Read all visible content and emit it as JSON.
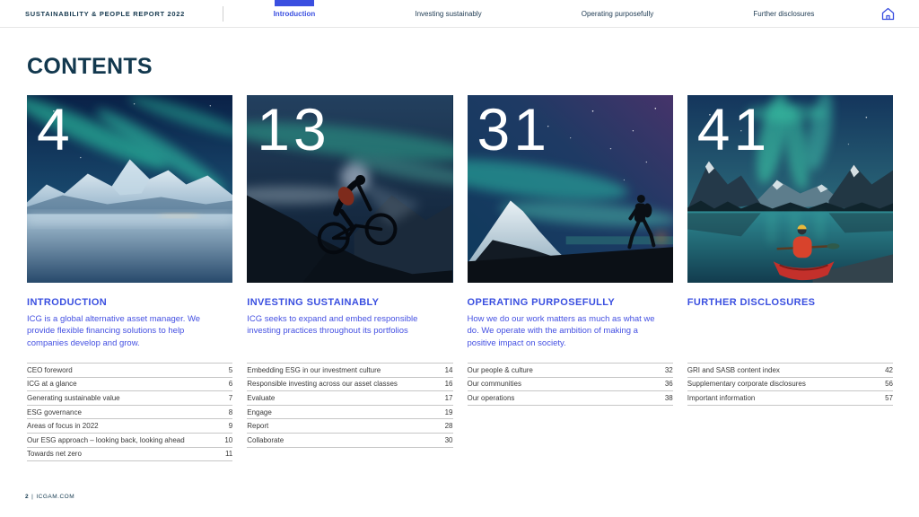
{
  "colors": {
    "accent": "#3A4FE0",
    "title_navy": "#12384E",
    "aurora_teal": "#2FD6AC"
  },
  "header": {
    "report_title": "SUSTAINABILITY & PEOPLE REPORT 2022",
    "tabs": [
      {
        "label": "Introduction",
        "active": true
      },
      {
        "label": "Investing sustainably",
        "active": false
      },
      {
        "label": "Operating purposefully",
        "active": false
      },
      {
        "label": "Further disclosures",
        "active": false
      }
    ],
    "icons": {
      "home": "home-icon"
    }
  },
  "page_title": "CONTENTS",
  "sections": [
    {
      "number": "4",
      "title": "INTRODUCTION",
      "description": "ICG is a global alternative asset manager. We provide flexible financing solutions to help companies develop and grow.",
      "image": "aurora-over-snowy-mountains-and-sea",
      "items": [
        {
          "label": "CEO foreword",
          "page": "5"
        },
        {
          "label": "ICG at a glance",
          "page": "6"
        },
        {
          "label": "Generating sustainable value",
          "page": "7"
        },
        {
          "label": "ESG governance",
          "page": "8"
        },
        {
          "label": "Areas of focus in 2022",
          "page": "9"
        },
        {
          "label": "Our ESG approach – looking back, looking ahead",
          "page": "10"
        },
        {
          "label": "Towards net zero",
          "page": "11"
        }
      ]
    },
    {
      "number": "13",
      "title": "INVESTING SUSTAINABLY",
      "description": "ICG seeks to expand and embed responsible investing practices throughout its portfolios",
      "image": "mountain-biker-under-aurora-sky",
      "items": [
        {
          "label": "Embedding ESG in our investment culture",
          "page": "14"
        },
        {
          "label": "Responsible investing across our asset classes",
          "page": "16"
        },
        {
          "label": "Evaluate",
          "page": "17"
        },
        {
          "label": "Engage",
          "page": "19"
        },
        {
          "label": "Report",
          "page": "28"
        },
        {
          "label": "Collaborate",
          "page": "30"
        }
      ]
    },
    {
      "number": "31",
      "title": "OPERATING PURPOSEFULLY",
      "description": "How we do our work matters as much as what we do. We operate with the ambition of making a positive impact on society.",
      "image": "hiker-walking-under-aurora-and-snowy-peak",
      "items": [
        {
          "label": "Our people & culture",
          "page": "32"
        },
        {
          "label": "Our communities",
          "page": "36"
        },
        {
          "label": "Our operations",
          "page": "38"
        }
      ]
    },
    {
      "number": "41",
      "title": "FURTHER DISCLOSURES",
      "description": "",
      "image": "red-canoe-on-mountain-lake-with-aurora",
      "items": [
        {
          "label": "GRI and SASB content index",
          "page": "42"
        },
        {
          "label": "Supplementary corporate disclosures",
          "page": "56"
        },
        {
          "label": "Important information",
          "page": "57"
        }
      ]
    }
  ],
  "footer": {
    "page_number": "2",
    "separator": "|",
    "site": "ICGAM.COM"
  }
}
